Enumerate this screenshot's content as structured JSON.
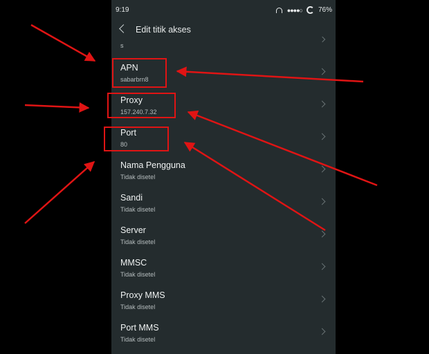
{
  "status": {
    "time": "9:19",
    "battery": "76%",
    "headphone_icon": "headphone-icon",
    "signal_icon": "signal-dots-icon",
    "sync_icon": "loading-icon"
  },
  "appbar": {
    "title": "Edit titik akses",
    "back_icon": "back-arrow-icon"
  },
  "cut_row": {
    "value": "s"
  },
  "rows": [
    {
      "label": "APN",
      "value": "sabarbrn8"
    },
    {
      "label": "Proxy",
      "value": "157.240.7.32"
    },
    {
      "label": "Port",
      "value": "80"
    },
    {
      "label": "Nama Pengguna",
      "value": "Tidak disetel"
    },
    {
      "label": "Sandi",
      "value": "Tidak disetel"
    },
    {
      "label": "Server",
      "value": "Tidak disetel"
    },
    {
      "label": "MMSC",
      "value": "Tidak disetel"
    },
    {
      "label": "Proxy MMS",
      "value": "Tidak disetel"
    },
    {
      "label": "Port MMS",
      "value": "Tidak disetel"
    }
  ],
  "colors": {
    "background": "#000000",
    "panel": "#242c2e",
    "text": "#eef1f1",
    "subtext": "#b5bcbd",
    "annotation": "#e01414"
  }
}
